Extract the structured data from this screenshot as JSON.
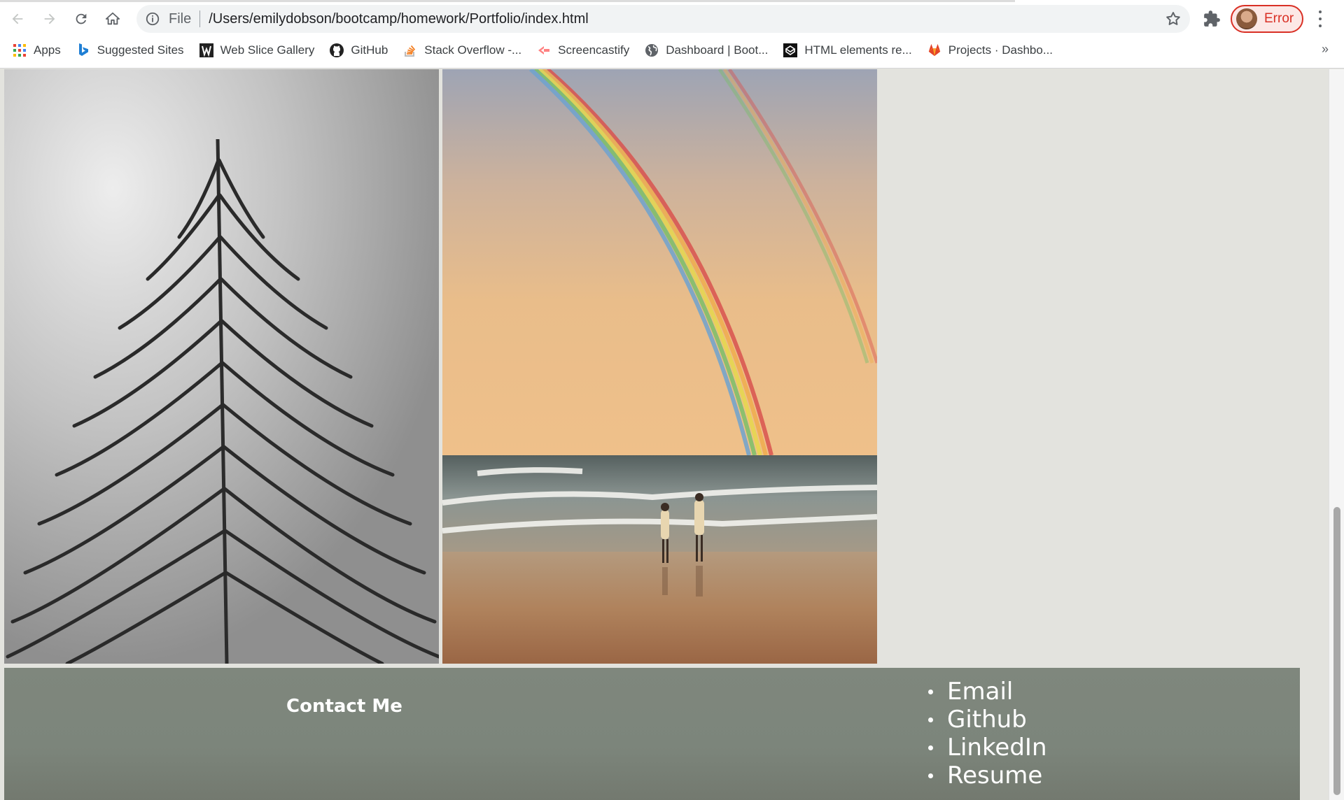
{
  "browser": {
    "url_scheme_label": "File",
    "url": "/Users/emilydobson/bootcamp/homework/Portfolio/index.html",
    "profile_label": "Error",
    "bookmarks": [
      {
        "label": "Apps",
        "icon": "apps-grid-icon"
      },
      {
        "label": "Suggested Sites",
        "icon": "bing-icon"
      },
      {
        "label": "Web Slice Gallery",
        "icon": "web-slice-icon"
      },
      {
        "label": "GitHub",
        "icon": "github-icon"
      },
      {
        "label": "Stack Overflow -...",
        "icon": "stackoverflow-icon"
      },
      {
        "label": "Screencastify",
        "icon": "screencastify-icon"
      },
      {
        "label": "Dashboard | Boot...",
        "icon": "globe-icon"
      },
      {
        "label": "HTML elements re...",
        "icon": "codepen-icon"
      },
      {
        "label": "Projects · Dashbo...",
        "icon": "gitlab-icon"
      }
    ],
    "more_bookmarks": "»"
  },
  "page": {
    "footer": {
      "contact_title": "Contact Me",
      "links": [
        "Email",
        "Github",
        "LinkedIn",
        "Resume"
      ]
    }
  },
  "colors": {
    "page_bg": "#e3e3de",
    "footer_bg": "#7f877d",
    "profile_error": "#d93025"
  }
}
